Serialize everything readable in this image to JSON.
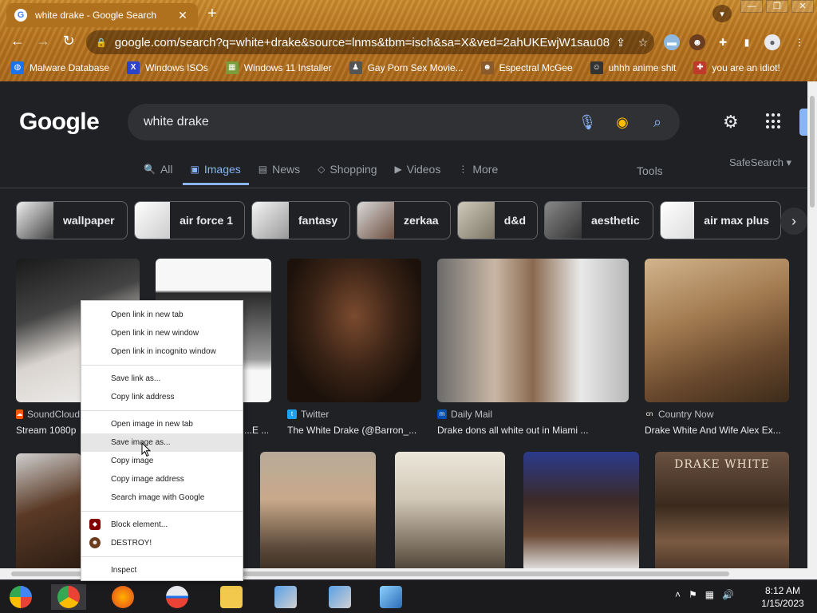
{
  "browser": {
    "tab_title": "white drake - Google Search",
    "tab_close": "✕",
    "new_tab": "+",
    "url": "google.com/search?q=white+drake&source=lnms&tbm=isch&sa=X&ved=2ahUKEwjW1sau08n...",
    "window_controls": [
      "—",
      "❐",
      "✕"
    ],
    "bookmarks": [
      {
        "label": "Malware Database",
        "icon": "globe-icon",
        "color": "#1a73e8"
      },
      {
        "label": "Windows ISOs",
        "icon": "x-logo-icon",
        "color": "#2b44c9"
      },
      {
        "label": "Windows 11 Installer",
        "icon": "image-icon",
        "color": "#7b9c3a"
      },
      {
        "label": "Gay Porn Sex Movie...",
        "icon": "figure-icon",
        "color": "#555555"
      },
      {
        "label": "Espectral McGee",
        "icon": "face-icon",
        "color": "#8a5a2a"
      },
      {
        "label": "uhhh anime shit",
        "icon": "face-icon",
        "color": "#333333"
      },
      {
        "label": "you are an idiot!",
        "icon": "flag-icon",
        "color": "#c0392b"
      }
    ]
  },
  "google": {
    "logo": "Google",
    "query": "white drake",
    "tabs": [
      {
        "label": "All",
        "icon": "🔍"
      },
      {
        "label": "Images",
        "icon": "▣",
        "active": true
      },
      {
        "label": "News",
        "icon": "▤"
      },
      {
        "label": "Shopping",
        "icon": "◇"
      },
      {
        "label": "Videos",
        "icon": "▶"
      },
      {
        "label": "More",
        "icon": "⋮"
      }
    ],
    "tools": "Tools",
    "safesearch": "SafeSearch ▾",
    "chips": [
      "wallpaper",
      "air force 1",
      "fantasy",
      "zerkaa",
      "d&d",
      "aesthetic",
      "air max plus"
    ],
    "results_row1": [
      {
        "source": "SoundCloud",
        "title": "Stream 1080p",
        "color": "#ff5500"
      },
      {
        "source": "",
        "title": "...E ...",
        "color": "#888888"
      },
      {
        "source": "Twitter",
        "title": "The White Drake (@Barron_...",
        "color": "#1da1f2"
      },
      {
        "source": "Daily Mail",
        "title": "Drake dons all white out in Miami ...",
        "color": "#004db3"
      },
      {
        "source": "Country Now",
        "title": "Drake White And Wife Alex Ex...",
        "color": "#222222"
      }
    ],
    "row2_overlay_text": "DRAKE WHITE"
  },
  "context_menu": {
    "groups": [
      [
        "Open link in new tab",
        "Open link in new window",
        "Open link in incognito window"
      ],
      [
        "Save link as...",
        "Copy link address"
      ],
      [
        "Open image in new tab",
        "Save image as...",
        "Copy image",
        "Copy image address",
        "Search image with Google"
      ],
      [
        "Block element...",
        "DESTROY!"
      ],
      [
        "Inspect"
      ]
    ],
    "highlighted": "Save image as..."
  },
  "taskbar": {
    "time": "8:12 AM",
    "date": "1/15/2023"
  },
  "colors": {
    "accent": "#8ab4f8",
    "page_bg": "#202124",
    "searchbox_bg": "#303134"
  }
}
